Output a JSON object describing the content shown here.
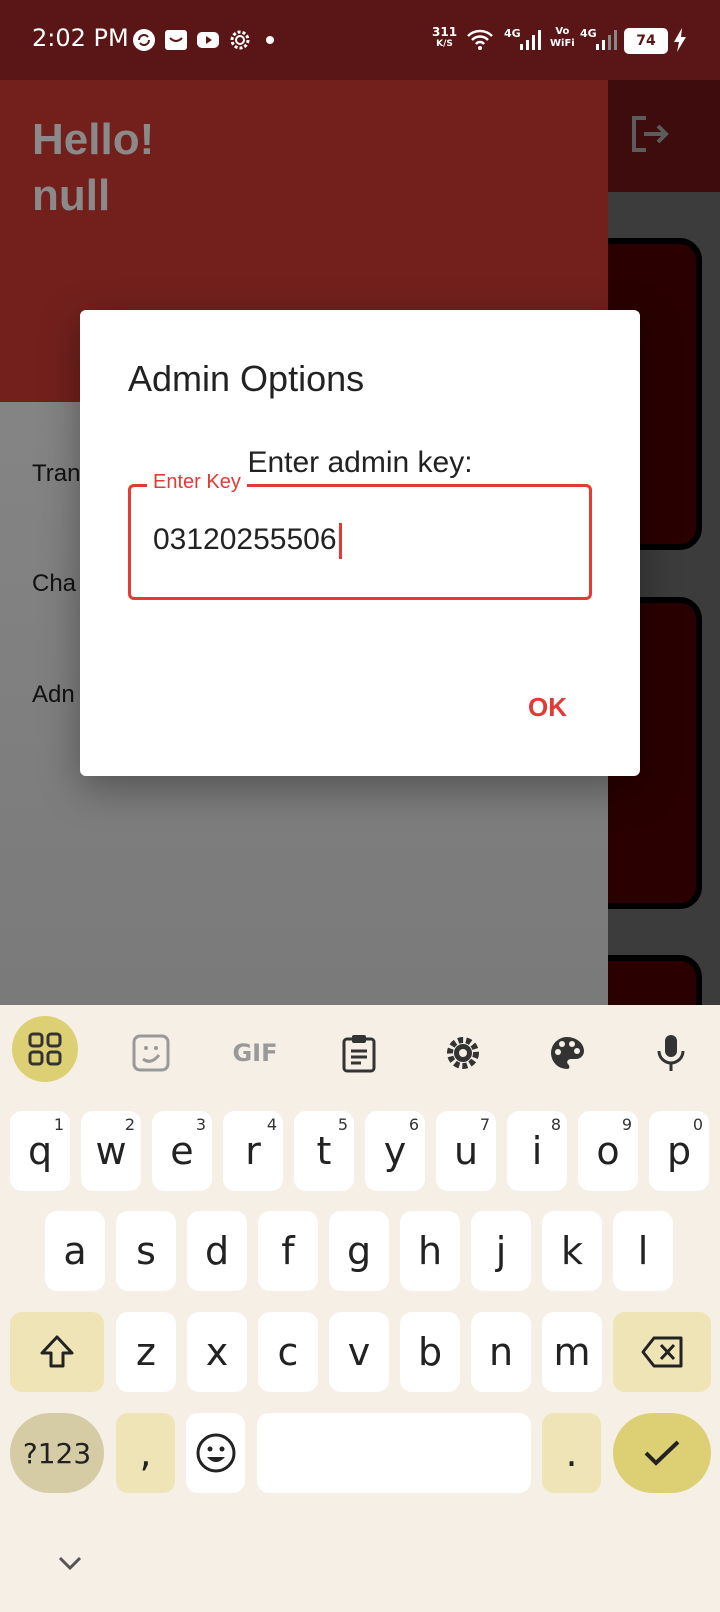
{
  "status_bar": {
    "time": "2:02 PM",
    "net_speed_top": "311",
    "net_speed_bottom": "K/S",
    "net1": "4G",
    "vo": "Vo",
    "wifi": "WiFi",
    "net2": "4G",
    "battery": "74"
  },
  "drawer": {
    "greeting_line1": "Hello!",
    "greeting_line2": "null",
    "items": [
      {
        "label": "Tran"
      },
      {
        "label": "Cha"
      },
      {
        "label": "Adn"
      }
    ]
  },
  "dialog": {
    "title": "Admin Options",
    "subtitle": "Enter admin key:",
    "field_label": "Enter Key",
    "field_value": "03120255506",
    "ok_label": "OK"
  },
  "keyboard": {
    "toolbar": [
      "apps-icon",
      "sticker-icon",
      "gif-icon",
      "clipboard-icon",
      "settings-icon",
      "palette-icon",
      "mic-icon"
    ],
    "gif_label": "GIF",
    "row1": [
      {
        "k": "q",
        "h": "1"
      },
      {
        "k": "w",
        "h": "2"
      },
      {
        "k": "e",
        "h": "3"
      },
      {
        "k": "r",
        "h": "4"
      },
      {
        "k": "t",
        "h": "5"
      },
      {
        "k": "y",
        "h": "6"
      },
      {
        "k": "u",
        "h": "7"
      },
      {
        "k": "i",
        "h": "8"
      },
      {
        "k": "o",
        "h": "9"
      },
      {
        "k": "p",
        "h": "0"
      }
    ],
    "row2": [
      "a",
      "s",
      "d",
      "f",
      "g",
      "h",
      "j",
      "k",
      "l"
    ],
    "row3": [
      "z",
      "x",
      "c",
      "v",
      "b",
      "n",
      "m"
    ],
    "symbols_label": "?123",
    "comma": ",",
    "period": ".",
    "accent_color": "#ddd074"
  },
  "colors": {
    "primary": "#e53935",
    "drawer_header": "#73201d"
  }
}
